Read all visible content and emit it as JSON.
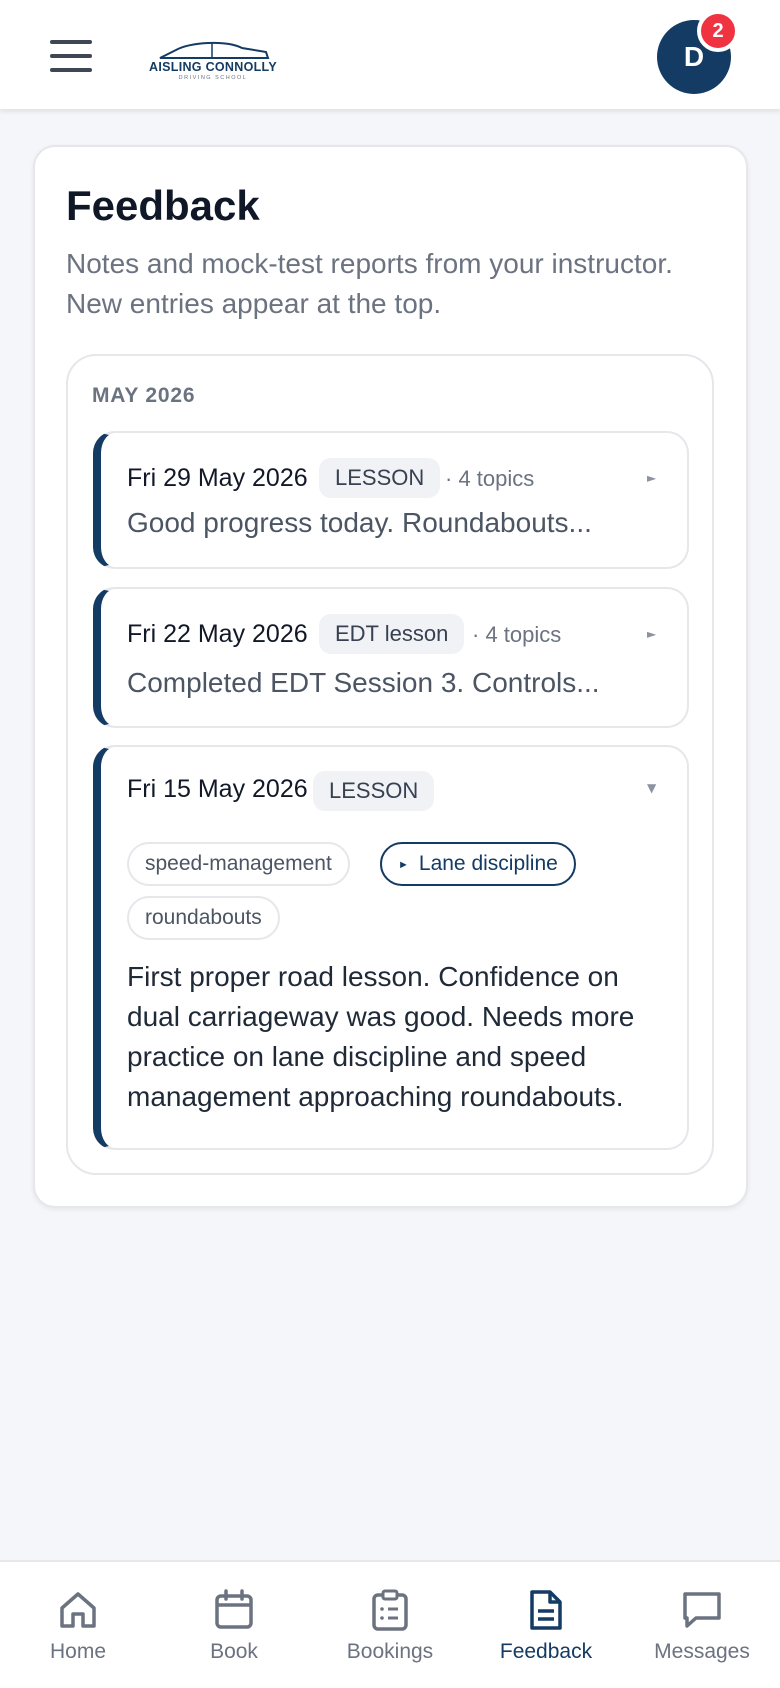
{
  "header": {
    "logo_text": "AISLING CONNOLLY",
    "logo_sub": "DRIVING SCHOOL",
    "avatar_initial": "D",
    "notification_count": "2"
  },
  "page": {
    "title": "Feedback",
    "subtitle": "Notes and mock-test reports from your instructor. New entries appear at the top."
  },
  "groups": [
    {
      "month": "MAY 2026",
      "entries": [
        {
          "date": "Fri 29 May 2026",
          "type": "LESSON",
          "topics": "· 4 topics",
          "preview": "Good progress today. Roundabouts...",
          "expanded": false
        },
        {
          "date": "Fri 22 May 2026",
          "type": "EDT lesson",
          "topics": "· 4 topics",
          "preview": "Completed EDT Session 3. Controls...",
          "expanded": false
        },
        {
          "date": "Fri 15 May 2026",
          "type": "LESSON",
          "expanded": true,
          "tags": [
            "speed-management",
            "Lane discipline",
            "roundabouts"
          ],
          "active_tag": "Lane discipline",
          "note": "First proper road lesson. Confidence on dual carriageway was good. Needs more practice on lane discipline and speed management approaching roundabouts."
        }
      ]
    }
  ],
  "nav": {
    "items": [
      {
        "label": "Home",
        "icon": "home-icon",
        "active": false
      },
      {
        "label": "Book",
        "icon": "calendar-icon",
        "active": false
      },
      {
        "label": "Bookings",
        "icon": "clipboard-list-icon",
        "active": false
      },
      {
        "label": "Feedback",
        "icon": "document-icon",
        "active": true
      },
      {
        "label": "Messages",
        "icon": "message-icon",
        "active": false
      }
    ]
  },
  "colors": {
    "brand": "#143b63",
    "badge": "#ef3340",
    "background": "#f5f6f9",
    "muted_text": "#6b7280"
  }
}
